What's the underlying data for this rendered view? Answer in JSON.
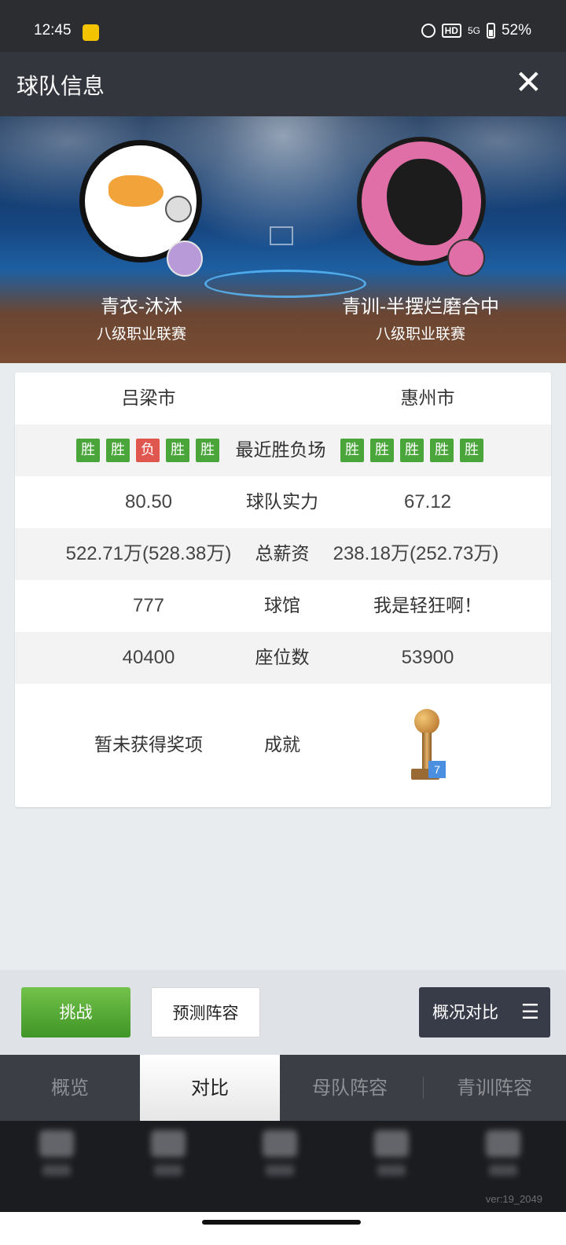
{
  "status_bar": {
    "time": "12:45",
    "battery": "52%",
    "network": "5G",
    "hd": "HD"
  },
  "header": {
    "title": "球队信息",
    "close_icon": "close-icon"
  },
  "teams": {
    "left": {
      "name": "青衣-沐沐",
      "league": "八级职业联赛"
    },
    "right": {
      "name": "青训-半摆烂磨合中",
      "league": "八级职业联赛"
    }
  },
  "compare": {
    "city": {
      "left": "吕梁市",
      "right": "惠州市"
    },
    "recent": {
      "label": "最近胜负场",
      "left": [
        "胜",
        "胜",
        "负",
        "胜",
        "胜"
      ],
      "right": [
        "胜",
        "胜",
        "胜",
        "胜",
        "胜"
      ]
    },
    "strength": {
      "label": "球队实力",
      "left": "80.50",
      "right": "67.12"
    },
    "salary": {
      "label": "总薪资",
      "left": "522.71万(528.38万)",
      "right": "238.18万(252.73万)"
    },
    "arena": {
      "label": "球馆",
      "left": "777",
      "right": "我是轻狂啊！"
    },
    "seats": {
      "label": "座位数",
      "left": "40400",
      "right": "53900"
    },
    "achievement": {
      "label": "成就",
      "left": "暂未获得奖项",
      "right_count": "7"
    }
  },
  "actions": {
    "challenge": "挑战",
    "predict": "预测阵容",
    "overview": "概况对比",
    "menu_glyph": "☰"
  },
  "tabs": [
    "概览",
    "对比",
    "母队阵容",
    "青训阵容"
  ],
  "active_tab": "对比",
  "version": "ver:19_2049",
  "colors": {
    "win": "#4aa53a",
    "loss": "#e0574f",
    "challenge": "#52a834",
    "header": "#33363c"
  }
}
